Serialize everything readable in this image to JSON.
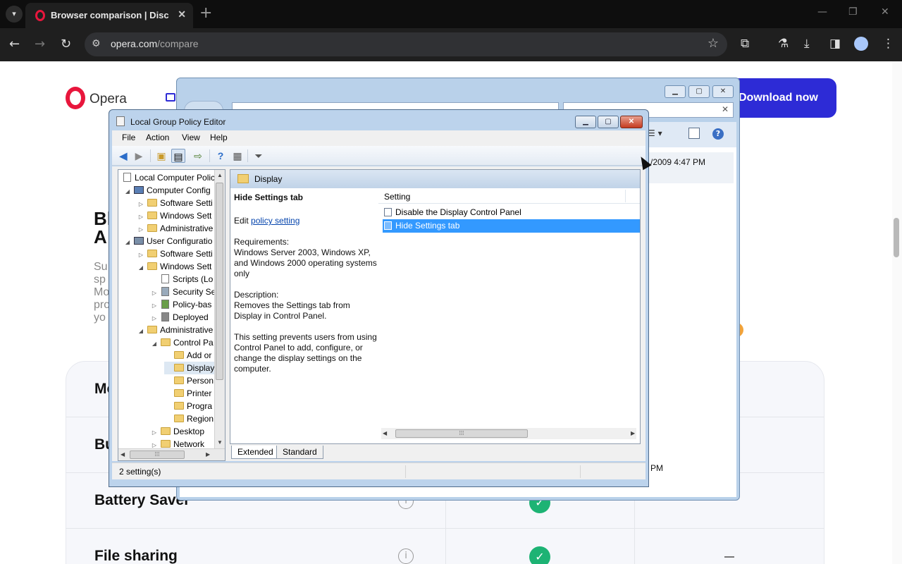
{
  "browser": {
    "tab_title": "Browser comparison | Discover",
    "url_host": "opera.com",
    "url_path": "/compare"
  },
  "opera_page": {
    "logo_text": "Opera",
    "download_label": "Download now",
    "hero_heading": "Bl A",
    "hero_para": "Su sp Mo pro yo",
    "features": [
      "Mo",
      "Bu",
      "Battery Saver",
      "File sharing"
    ]
  },
  "explorer": {
    "date_text": "/2009 4:47 PM",
    "date_text_2": "PM"
  },
  "gpe": {
    "title": "Local Group Policy Editor",
    "menus": [
      "File",
      "Action",
      "View",
      "Help"
    ],
    "tree": [
      {
        "label": "Local Computer Polic",
        "indent": 0
      },
      {
        "label": "Computer Config",
        "indent": 1
      },
      {
        "label": "Software Setti",
        "indent": 2
      },
      {
        "label": "Windows Sett",
        "indent": 2
      },
      {
        "label": "Administrative",
        "indent": 2
      },
      {
        "label": "User Configuratio",
        "indent": 1
      },
      {
        "label": "Software Setti",
        "indent": 2
      },
      {
        "label": "Windows Sett",
        "indent": 2
      },
      {
        "label": "Scripts (Lo",
        "indent": 3
      },
      {
        "label": "Security Se",
        "indent": 3
      },
      {
        "label": "Policy-bas",
        "indent": 3
      },
      {
        "label": "Deployed",
        "indent": 3
      },
      {
        "label": "Administrative",
        "indent": 2
      },
      {
        "label": "Control Pa",
        "indent": 3
      },
      {
        "label": "Add or",
        "indent": 4
      },
      {
        "label": "Display",
        "indent": 4
      },
      {
        "label": "Person",
        "indent": 4
      },
      {
        "label": "Printer",
        "indent": 4
      },
      {
        "label": "Progra",
        "indent": 4
      },
      {
        "label": "Region",
        "indent": 4
      },
      {
        "label": "Desktop",
        "indent": 3
      },
      {
        "label": "Network",
        "indent": 3
      }
    ],
    "header_folder": "Display",
    "desc_heading": "Hide Settings tab",
    "desc_edit_prefix": "Edit",
    "desc_edit_link": "policy setting",
    "desc_req_label": "Requirements:",
    "desc_req_text": "Windows Server 2003, Windows XP, and Windows 2000 operating systems only",
    "desc_desc_label": "Description:",
    "desc_desc_text": "Removes the Settings tab from Display in Control Panel.",
    "desc_extra": "This setting prevents users from using Control Panel to add, configure, or change the display settings on the computer.",
    "column_setting": "Setting",
    "settings": [
      "Disable the Display Control Panel",
      "Hide Settings tab"
    ],
    "tabs": [
      "Extended",
      "Standard"
    ],
    "status": "2 setting(s)"
  }
}
